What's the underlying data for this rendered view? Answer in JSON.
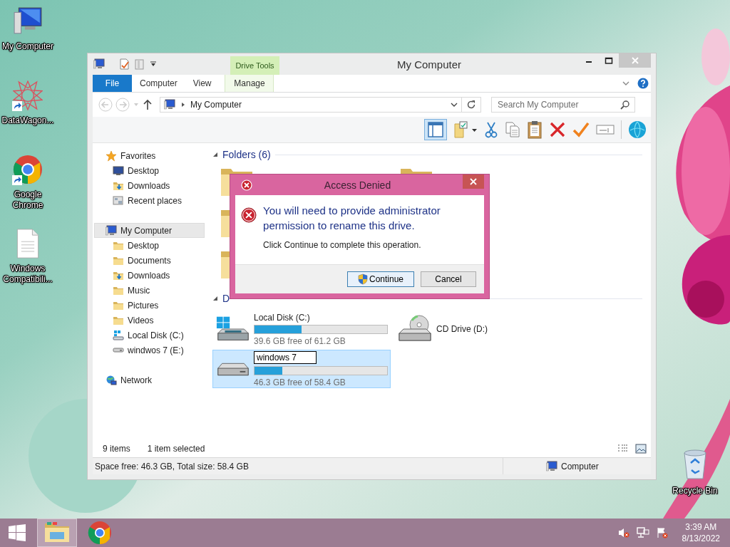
{
  "desktop": {
    "icons": [
      {
        "label": "My Computer",
        "kind": "computer",
        "shortcut": false
      },
      {
        "label": "DataWagon...",
        "kind": "emblem",
        "shortcut": true
      },
      {
        "label": "Google Chrome",
        "kind": "browser",
        "shortcut": true
      },
      {
        "label": "Windows Compatibili...",
        "kind": "document",
        "shortcut": false
      }
    ],
    "recycle_bin": {
      "label": "Recycle Bin"
    }
  },
  "explorer": {
    "title": "My Computer",
    "contextual_group": "Drive Tools",
    "ribbon_tabs": [
      {
        "label": "File",
        "kind": "file"
      },
      {
        "label": "Computer",
        "kind": "tab"
      },
      {
        "label": "View",
        "kind": "tab"
      },
      {
        "label": "Manage",
        "kind": "contextual"
      }
    ],
    "address": {
      "path": "My Computer"
    },
    "search": {
      "placeholder": "Search My Computer"
    },
    "nav": [
      {
        "label": "Favorites",
        "kind": "favorites",
        "selected": false,
        "children": [
          {
            "label": "Desktop",
            "kind": "desktop",
            "selected": false
          },
          {
            "label": "Downloads",
            "kind": "downloads",
            "selected": false
          },
          {
            "label": "Recent places",
            "kind": "recent",
            "selected": false
          }
        ]
      },
      {
        "label": "My Computer",
        "kind": "computer",
        "selected": true,
        "children": [
          {
            "label": "Desktop",
            "kind": "desktop-folder",
            "selected": false
          },
          {
            "label": "Documents",
            "kind": "folder",
            "selected": false
          },
          {
            "label": "Downloads",
            "kind": "downloads",
            "selected": false
          },
          {
            "label": "Music",
            "kind": "folder",
            "selected": false
          },
          {
            "label": "Pictures",
            "kind": "folder",
            "selected": false
          },
          {
            "label": "Videos",
            "kind": "folder",
            "selected": false
          },
          {
            "label": "Local Disk (C:)",
            "kind": "system-disk",
            "selected": false
          },
          {
            "label": "windwos 7 (E:)",
            "kind": "disk",
            "selected": false
          }
        ]
      },
      {
        "label": "Network",
        "kind": "network",
        "selected": false
      }
    ],
    "groups": [
      {
        "title": "Folders (6)",
        "expanded": true
      },
      {
        "title": "D",
        "expanded": true
      }
    ],
    "drives": [
      {
        "name": "Local Disk (C:)",
        "kind": "system",
        "level": 0.353,
        "free": "39.6 GB free of 61.2 GB",
        "selected": false,
        "renaming": false
      },
      {
        "name": "CD Drive (D:)",
        "kind": "cd",
        "selected": false,
        "renaming": false
      },
      {
        "name": "windows 7",
        "kind": "disk",
        "level": 0.207,
        "free": "46.3 GB free of 58.4 GB",
        "selected": true,
        "renaming": true
      }
    ],
    "status": {
      "items": "9 items",
      "selection": "1 item selected"
    },
    "status_bar": {
      "space": "Space free: 46.3 GB, Total size: 58.4 GB",
      "location": "Computer"
    }
  },
  "dialog": {
    "title": "Access Denied",
    "message": "You will need to provide administrator permission to rename this drive.",
    "detail": "Click Continue to complete this operation.",
    "buttons": [
      {
        "label": "Continue",
        "kind": "elevated",
        "default": true
      },
      {
        "label": "Cancel",
        "kind": "plain",
        "default": false
      }
    ]
  },
  "taskbar": {
    "apps": [
      {
        "kind": "explorer",
        "active": true
      },
      {
        "kind": "browser",
        "active": false
      }
    ],
    "clock": {
      "time": "3:39 AM",
      "date": "8/13/2022"
    }
  }
}
